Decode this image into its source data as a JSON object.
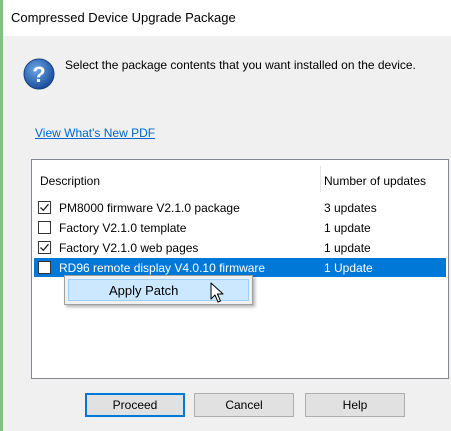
{
  "window": {
    "title": "Compressed Device Upgrade Package"
  },
  "message": {
    "text": "Select the package contents that you want installed on the device.",
    "icon": "question-icon"
  },
  "link": {
    "label": "View What's New PDF"
  },
  "list": {
    "columns": [
      "Description",
      "Number of updates"
    ],
    "rows": [
      {
        "description": "PM8000 firmware V2.1.0 package",
        "count": "3 updates",
        "checked": true,
        "selected": false
      },
      {
        "description": "Factory V2.1.0 template",
        "count": "1 update",
        "checked": false,
        "selected": false
      },
      {
        "description": "Factory V2.1.0 web pages",
        "count": "1 update",
        "checked": true,
        "selected": false
      },
      {
        "description": "RD96 remote display V4.0.10 firmware",
        "count": "1 Update",
        "checked": false,
        "selected": true
      }
    ]
  },
  "context_menu": {
    "items": [
      "Apply Patch"
    ]
  },
  "buttons": {
    "proceed": "Proceed",
    "cancel": "Cancel",
    "help": "Help"
  },
  "colors": {
    "selection": "#0078d7",
    "link": "#0066cc",
    "accent_border": "#7ec47e"
  }
}
